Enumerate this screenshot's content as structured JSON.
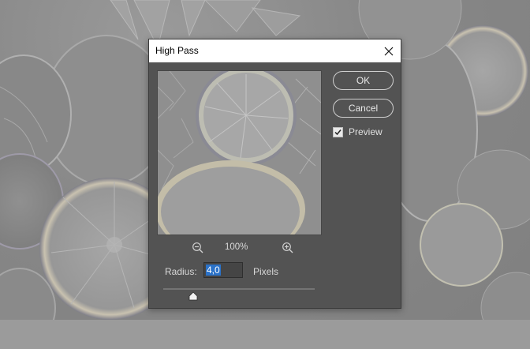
{
  "dialog": {
    "title": "High Pass",
    "ok_label": "OK",
    "cancel_label": "Cancel",
    "preview_label": "Preview",
    "preview_checked": true,
    "zoom_level": "100%",
    "radius_label": "Radius:",
    "radius_value": "4,0",
    "radius_unit": "Pixels",
    "radius_slider_fraction": 0.2
  },
  "icons": {
    "close": "close-icon",
    "zoom_out": "zoom-out-icon",
    "zoom_in": "zoom-in-icon",
    "check": "check-icon",
    "slider_thumb": "slider-thumb-icon"
  },
  "colors": {
    "dialog_bg": "#535353",
    "titlebar_bg": "#ffffff",
    "selection": "#2b72c8",
    "photo_bg": "#8c8c8c"
  }
}
